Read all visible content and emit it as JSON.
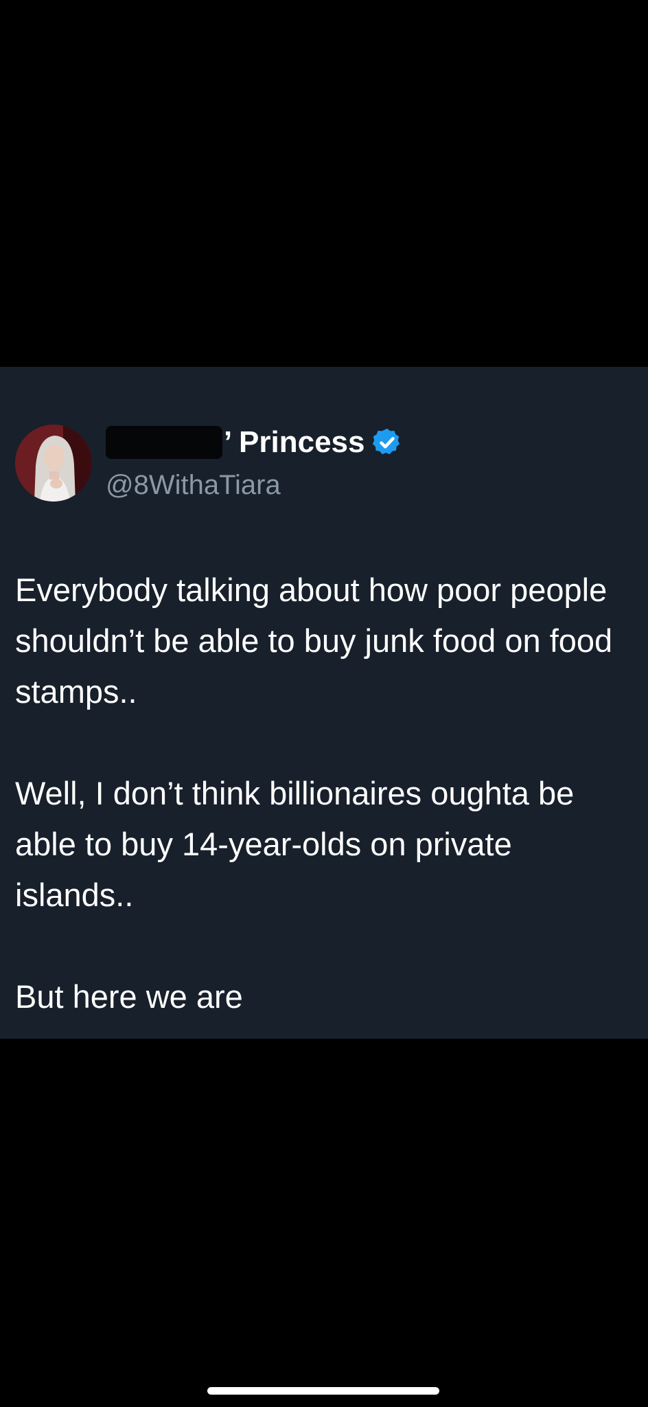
{
  "tweet": {
    "author": {
      "display_name_visible": "’ Princess",
      "handle": "@8WithaTiara",
      "verified": true,
      "verified_badge_color": "#1d9bf0",
      "avatar_icon": "profile-avatar"
    },
    "paragraphs": [
      "Everybody talking about how poor people shouldn’t be able to buy junk food on food stamps..",
      "Well, I don’t think billionaires oughta be able to buy 14-year-olds on private islands..",
      "But here we are"
    ]
  },
  "colors": {
    "background": "#000000",
    "card_background": "#18202b",
    "text_primary": "#ffffff",
    "text_secondary": "#8b98a5"
  }
}
